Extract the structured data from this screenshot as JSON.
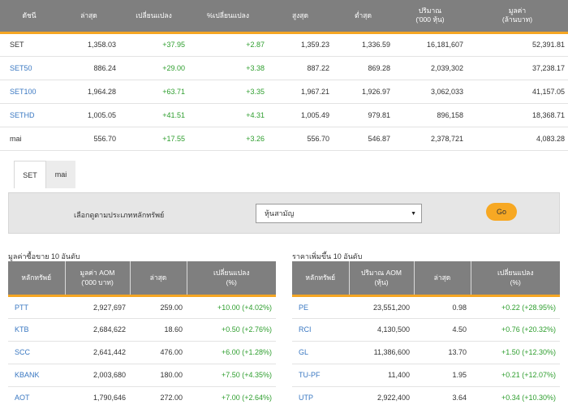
{
  "index_table": {
    "headers": [
      "ดัชนี",
      "ล่าสุด",
      "เปลี่ยนแปลง",
      "%เปลี่ยนแปลง",
      "สูงสุด",
      "ต่ำสุด",
      [
        "ปริมาณ",
        "('000 หุ้น)"
      ],
      [
        "มูลค่า",
        "(ล้านบาท)"
      ]
    ],
    "rows": [
      {
        "name": "SET",
        "last": "1,358.03",
        "change": "+37.95",
        "pct": "+2.87",
        "high": "1,359.23",
        "low": "1,336.59",
        "volume": "16,181,607",
        "value": "52,391.81"
      },
      {
        "name": "SET50",
        "last": "886.24",
        "change": "+29.00",
        "pct": "+3.38",
        "high": "887.22",
        "low": "869.28",
        "volume": "2,039,302",
        "value": "37,238.17"
      },
      {
        "name": "SET100",
        "last": "1,964.28",
        "change": "+63.71",
        "pct": "+3.35",
        "high": "1,967.21",
        "low": "1,926.97",
        "volume": "3,062,033",
        "value": "41,157.05"
      },
      {
        "name": "SETHD",
        "last": "1,005.05",
        "change": "+41.51",
        "pct": "+4.31",
        "high": "1,005.49",
        "low": "979.81",
        "volume": "896,158",
        "value": "18,368.71"
      },
      {
        "name": "mai",
        "last": "556.70",
        "change": "+17.55",
        "pct": "+3.26",
        "high": "556.70",
        "low": "546.87",
        "volume": "2,378,721",
        "value": "4,083.28"
      }
    ]
  },
  "tabs": [
    {
      "label": "SET",
      "active": true
    },
    {
      "label": "mai",
      "active": false
    }
  ],
  "filter": {
    "label": "เลือกดูตามประเภทหลักทรัพย์",
    "selected": "หุ้นสามัญ",
    "go_label": "Go"
  },
  "top_value": {
    "title": "มูลค่าซื้อขาย 10 อันดับ",
    "headers": [
      "หลักทรัพย์",
      [
        "มูลค่า AOM",
        "('000 บาท)"
      ],
      "ล่าสุด",
      [
        "เปลี่ยนแปลง",
        "(%)"
      ]
    ],
    "rows": [
      {
        "symbol": "PTT",
        "value": "2,927,697",
        "last": "259.00",
        "change": "+10.00 (+4.02%)"
      },
      {
        "symbol": "KTB",
        "value": "2,684,622",
        "last": "18.60",
        "change": "+0.50 (+2.76%)"
      },
      {
        "symbol": "SCC",
        "value": "2,641,442",
        "last": "476.00",
        "change": "+6.00 (+1.28%)"
      },
      {
        "symbol": "KBANK",
        "value": "2,003,680",
        "last": "180.00",
        "change": "+7.50 (+4.35%)"
      },
      {
        "symbol": "AOT",
        "value": "1,790,646",
        "last": "272.00",
        "change": "+7.00 (+2.64%)"
      }
    ]
  },
  "top_gainers": {
    "title": "ราคาเพิ่มขึ้น 10 อันดับ",
    "headers": [
      "หลักทรัพย์",
      [
        "ปริมาณ AOM",
        "(หุ้น)"
      ],
      "ล่าสุด",
      [
        "เปลี่ยนแปลง",
        "(%)"
      ]
    ],
    "rows": [
      {
        "symbol": "PE",
        "volume": "23,551,200",
        "last": "0.98",
        "change": "+0.22 (+28.95%)"
      },
      {
        "symbol": "RCI",
        "volume": "4,130,500",
        "last": "4.50",
        "change": "+0.76 (+20.32%)"
      },
      {
        "symbol": "GL",
        "volume": "11,386,600",
        "last": "13.70",
        "change": "+1.50 (+12.30%)"
      },
      {
        "symbol": "TU-PF",
        "volume": "11,400",
        "last": "1.95",
        "change": "+0.21 (+12.07%)"
      },
      {
        "symbol": "UTP",
        "volume": "2,922,400",
        "last": "3.64",
        "change": "+0.34 (+10.30%)"
      }
    ]
  },
  "colors": {
    "header_bg": "#7f7f7f",
    "accent": "#f5a623",
    "positive": "#2e9e2e",
    "link": "#3a78c2"
  }
}
